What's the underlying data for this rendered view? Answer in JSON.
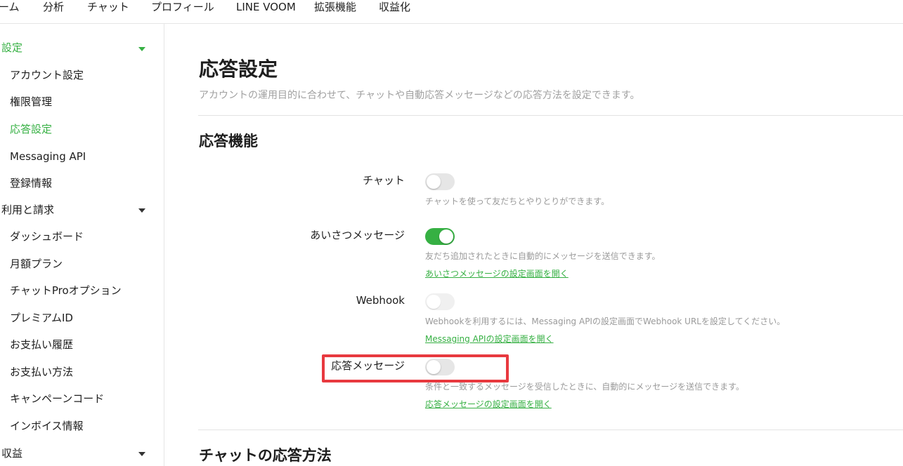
{
  "topnav": {
    "items": [
      "ーム",
      "分析",
      "チャット",
      "プロフィール",
      "LINE VOOM",
      "拡張機能",
      "収益化"
    ]
  },
  "sidebar": {
    "groups": [
      {
        "label": "設定",
        "items": [
          "アカウント設定",
          "権限管理",
          "応答設定",
          "Messaging API",
          "登録情報"
        ]
      },
      {
        "label": "利用と請求",
        "items": [
          "ダッシュボード",
          "月額プラン",
          "チャットProオプション",
          "プレミアムID",
          "お支払い履歴",
          "お支払い方法",
          "キャンペーンコード",
          "インボイス情報"
        ]
      },
      {
        "label": "収益",
        "items": []
      }
    ],
    "active_item": "応答設定"
  },
  "main": {
    "title": "応答設定",
    "description": "アカウントの運用目的に合わせて、チャットや自動応答メッセージなどの応答方法を設定できます。",
    "section1_title": "応答機能",
    "rows": [
      {
        "label": "チャット",
        "state": "off",
        "desc": "チャットを使って友だちとやりとりができます。",
        "link": ""
      },
      {
        "label": "あいさつメッセージ",
        "state": "on",
        "desc": "友だち追加されたときに自動的にメッセージを送信できます。",
        "link": "あいさつメッセージの設定画面を開く"
      },
      {
        "label": "Webhook",
        "state": "disabled",
        "desc": "Webhookを利用するには、Messaging APIの設定画面でWebhook URLを設定してください。",
        "link": "Messaging APIの設定画面を開く"
      },
      {
        "label": "応答メッセージ",
        "state": "off",
        "desc": "条件と一致するメッセージを受信したときに、自動的にメッセージを送信できます。",
        "link": "応答メッセージの設定画面を開く"
      }
    ],
    "section2_title": "チャットの応答方法"
  },
  "colors": {
    "accent": "#36b043",
    "highlight": "#e8393f"
  }
}
